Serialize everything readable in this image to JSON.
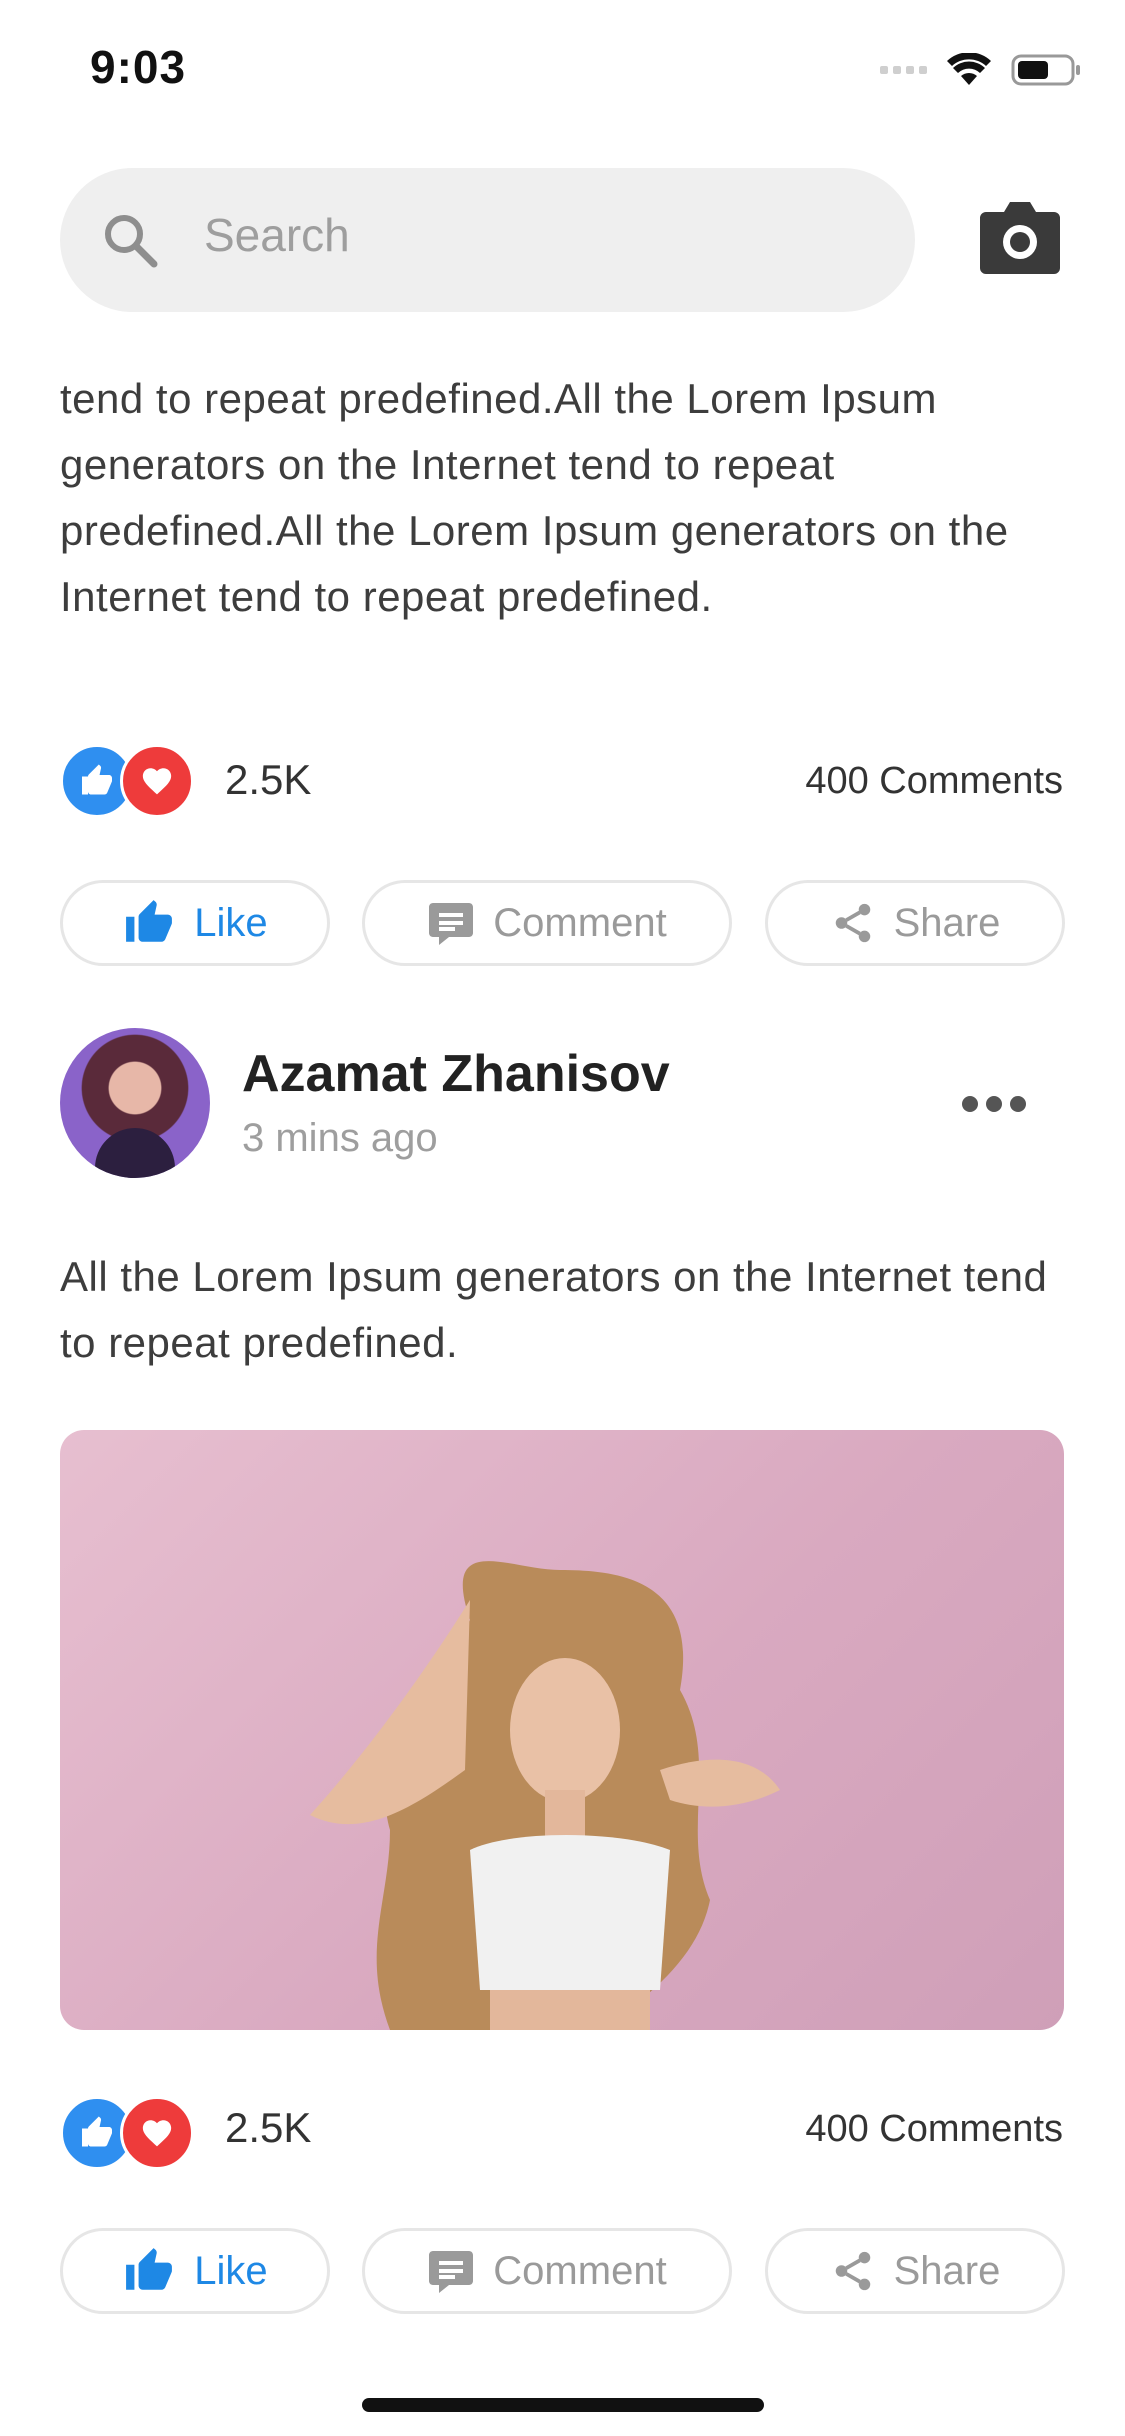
{
  "status_bar": {
    "time": "9:03"
  },
  "search": {
    "placeholder": "Search"
  },
  "top_post": {
    "text": "tend to repeat predefined.All the Lorem Ipsum generators on the Internet tend to repeat predefined.All the Lorem Ipsum generators on the Internet tend to repeat predefined.",
    "reaction_count": "2.5K",
    "comment_count": "400 Comments",
    "actions": {
      "like": "Like",
      "comment": "Comment",
      "share": "Share"
    }
  },
  "post": {
    "author": "Azamat Zhanisov",
    "time_ago": "3 mins ago",
    "text": "All the Lorem Ipsum generators on the Internet tend to repeat predefined.",
    "reaction_count": "2.5K",
    "comment_count": "400 Comments",
    "actions": {
      "like": "Like",
      "comment": "Comment",
      "share": "Share"
    }
  },
  "colors": {
    "accent_blue": "#1e88e5",
    "heart_red": "#ee3b3b",
    "search_bg": "#efefef",
    "image_pink": "#d9a9c0"
  },
  "icons": [
    "search-icon",
    "camera-icon",
    "thumbs-up-icon",
    "heart-icon",
    "comment-icon",
    "share-icon",
    "more-icon",
    "wifi-icon",
    "battery-icon",
    "signal-icon"
  ]
}
